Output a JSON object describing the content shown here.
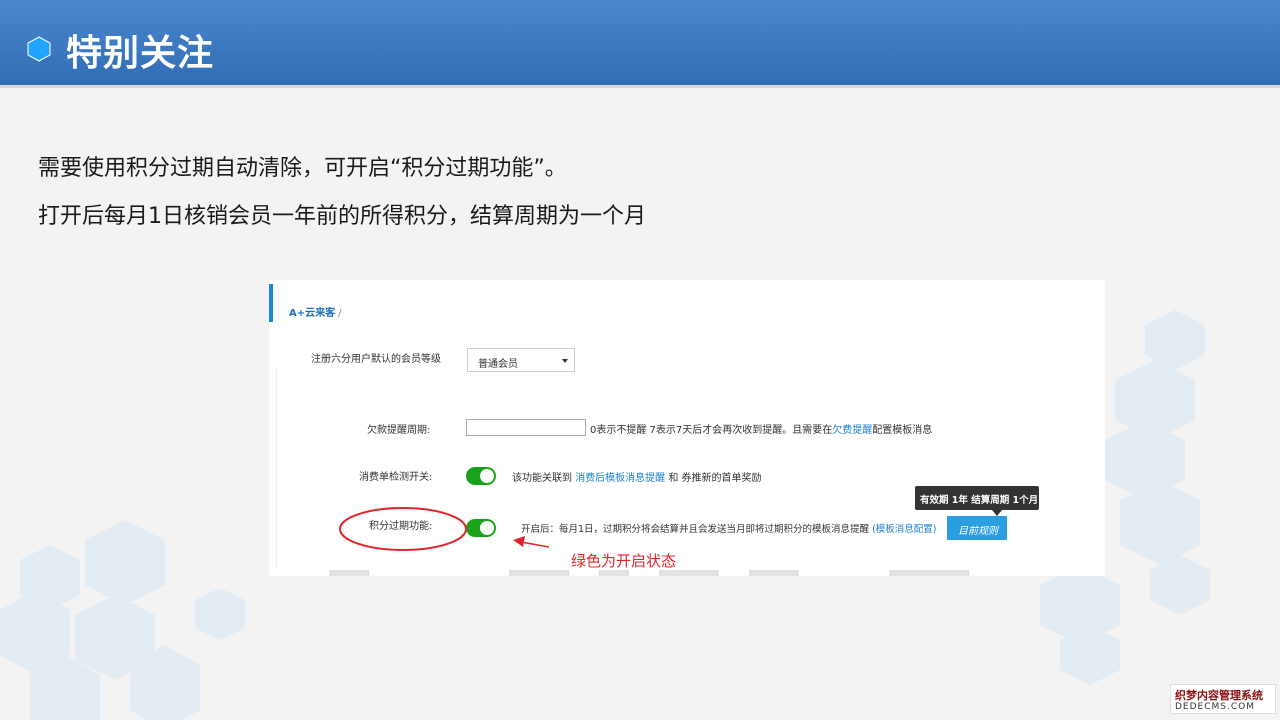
{
  "header": {
    "title": "特别关注",
    "icon": "hexagon-icon"
  },
  "intro": {
    "line1": "需要使用积分过期自动清除，可开启“积分过期功能”。",
    "line2": "打开后每月1日核销会员一年前的所得积分，结算周期为一个月"
  },
  "panel": {
    "breadcrumb": "A+云来客",
    "breadcrumb_sep": "/",
    "default_level": {
      "label": "注册六分用户默认的会员等级",
      "selected": "普通会员"
    },
    "reminder_period": {
      "label": "欠款提醒周期:",
      "value": "",
      "desc_prefix": "0表示不提醒 7表示7天后才会再次收到提醒。且需要在",
      "desc_link": "欠费提醒",
      "desc_suffix": "配置模板消息"
    },
    "consumption_check": {
      "label": "消费单检测开关:",
      "enabled": true,
      "desc_prefix": "该功能关联到",
      "desc_link": "消费后模板消息提醒",
      "desc_suffix": "和 券推新的首单奖励"
    },
    "points_expiry": {
      "label": "积分过期功能:",
      "enabled": true,
      "desc_prefix": "开启后：每月1日，过期积分将会结算并且会发送当月即将过期积分的模板消息提醒",
      "desc_link": "(模板消息配置)",
      "button": "目前规则",
      "tooltip": "有效期 1年 结算周期 1个月"
    },
    "annotation": "绿色为开启状态"
  },
  "watermark": {
    "line1": "织梦内容管理系统",
    "line2": "DEDECMS.COM"
  },
  "colors": {
    "header": "#3a78c2",
    "toggle_on": "#1aa31a",
    "link": "#1e80d0",
    "annotation": "#e0262b",
    "button": "#2a9ee0"
  }
}
